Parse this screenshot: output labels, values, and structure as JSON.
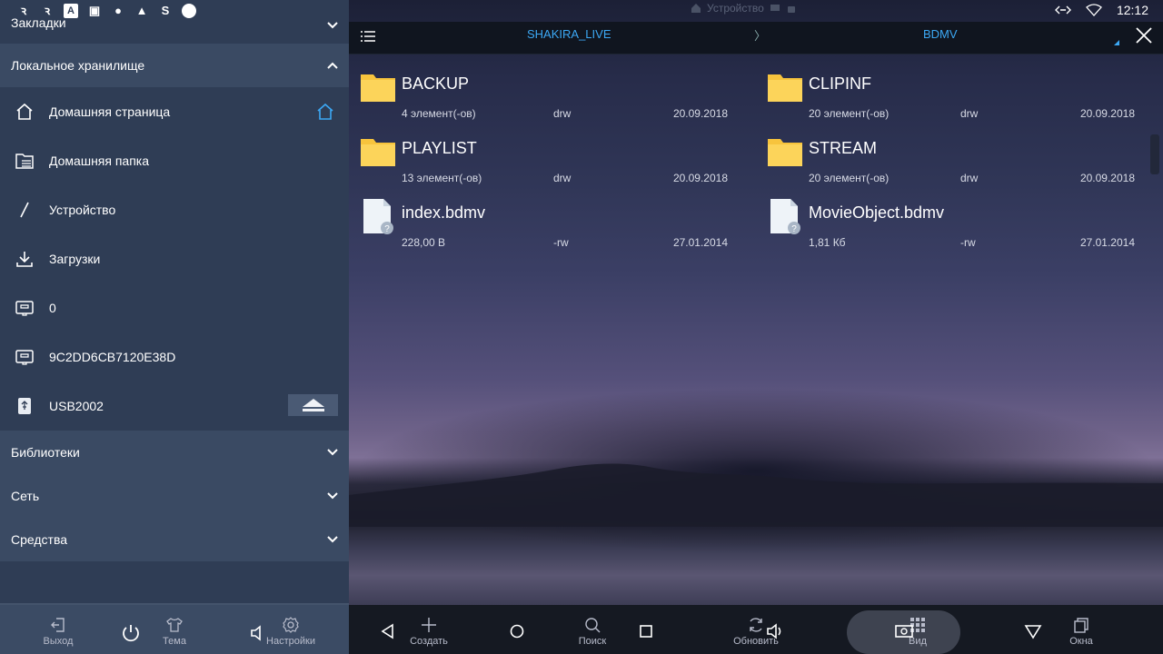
{
  "status_bar": {
    "center_text": "Устройство",
    "clock": "12:12",
    "left_icons": [
      "notification-icon-1",
      "notification-icon-2",
      "font-icon",
      "image-icon",
      "apple-icon",
      "scale-icon",
      "s-icon",
      "circle-icon"
    ]
  },
  "sidebar": {
    "bookmarks_header": "Закладки",
    "local_storage_header": "Локальное хранилище",
    "items": [
      {
        "label": "Домашняя страница",
        "icon": "home-icon"
      },
      {
        "label": "Домашняя папка",
        "icon": "folder-list-icon"
      },
      {
        "label": "Устройство",
        "icon": "slash-icon"
      },
      {
        "label": "Загрузки",
        "icon": "download-icon"
      },
      {
        "label": "0",
        "icon": "sd-card-icon"
      },
      {
        "label": "9C2DD6CB7120E38D",
        "icon": "sd-card-icon"
      },
      {
        "label": "USB2002",
        "icon": "usb-icon"
      }
    ],
    "libraries_header": "Библиотеки",
    "network_header": "Сеть",
    "tools_header": "Средства",
    "bottom_buttons": {
      "exit": "Выход",
      "theme": "Тема",
      "settings": "Настройки"
    }
  },
  "path_bar": {
    "crumb_1": "SHAKIRA_LIVE",
    "separator": "〉",
    "crumb_2": "BDMV"
  },
  "files": [
    {
      "name": "BACKUP",
      "meta": "4 элемент(-ов)",
      "perm": "drw",
      "date": "20.09.2018",
      "type": "folder"
    },
    {
      "name": "CLIPINF",
      "meta": "20 элемент(-ов)",
      "perm": "drw",
      "date": "20.09.2018",
      "type": "folder"
    },
    {
      "name": "PLAYLIST",
      "meta": "13 элемент(-ов)",
      "perm": "drw",
      "date": "20.09.2018",
      "type": "folder"
    },
    {
      "name": "STREAM",
      "meta": "20 элемент(-ов)",
      "perm": "drw",
      "date": "20.09.2018",
      "type": "folder"
    },
    {
      "name": "index.bdmv",
      "meta": "228,00 B",
      "perm": "-rw",
      "date": "27.01.2014",
      "type": "file"
    },
    {
      "name": "MovieObject.bdmv",
      "meta": "1,81 Кб",
      "perm": "-rw",
      "date": "27.01.2014",
      "type": "file"
    }
  ],
  "toolbar": {
    "create": "Создать",
    "search": "Поиск",
    "refresh": "Обновить",
    "view": "Вид",
    "windows": "Окна"
  },
  "colors": {
    "accent": "#3ca8f4",
    "sidebar_bg": "#2f3d55",
    "folder": "#f7c43d"
  }
}
